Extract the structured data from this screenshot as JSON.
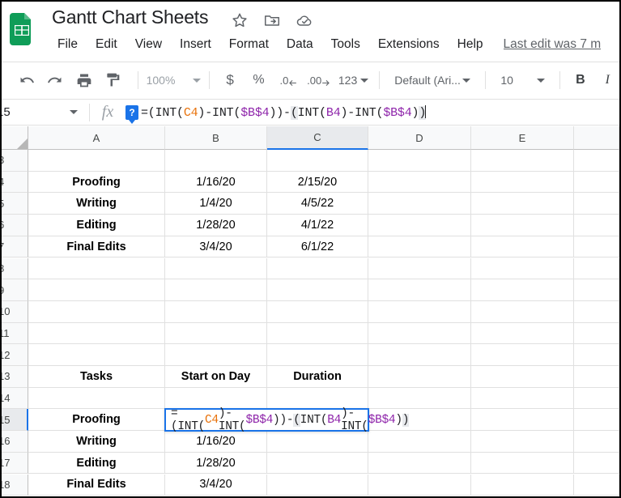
{
  "titlebar": {
    "doc_title": "Gantt Chart Sheets",
    "icons": [
      {
        "name": "star-icon",
        "label": "Star"
      },
      {
        "name": "move-to-folder-icon",
        "label": "Move"
      },
      {
        "name": "cloud-saved-icon",
        "label": "Saved to Drive"
      }
    ],
    "menus": [
      "File",
      "Edit",
      "View",
      "Insert",
      "Format",
      "Data",
      "Tools",
      "Extensions",
      "Help"
    ],
    "last_edit": "Last edit was 7 m"
  },
  "toolbar": {
    "undo": "undo-icon",
    "redo": "redo-icon",
    "print": "print-icon",
    "paint_format": "paint-format-icon",
    "zoom_value": "100%",
    "currency": "$",
    "percent": "%",
    "decrease_decimal": ".0",
    "increase_decimal": ".00",
    "number_format": "123",
    "font_name": "Default (Ari...",
    "font_size": "10",
    "bold": "B",
    "italic": "I"
  },
  "formula_bar": {
    "name_box": "15",
    "fx_label": "fx",
    "help_badge": "?",
    "formula_tokens": [
      {
        "text": "=(INT(",
        "style": "plain"
      },
      {
        "text": "C4",
        "style": "orange"
      },
      {
        "text": ")-INT(",
        "style": "plain"
      },
      {
        "text": "$B$4",
        "style": "purple"
      },
      {
        "text": "))-",
        "style": "plain"
      },
      {
        "text": "(",
        "style": "greybg"
      },
      {
        "text": "INT(",
        "style": "plain"
      },
      {
        "text": "B4",
        "style": "purple"
      },
      {
        "text": ")-INT(",
        "style": "plain"
      },
      {
        "text": "$B$4",
        "style": "purple"
      },
      {
        "text": ")",
        "style": "plain"
      },
      {
        "text": ")",
        "style": "greybg"
      }
    ],
    "formula_plain": "=(INT(C4)-INT($B$4))-(INT(B4)-INT($B$4))"
  },
  "grid": {
    "columns": [
      "A",
      "B",
      "C",
      "D",
      "E",
      ""
    ],
    "selected_column": "C",
    "rows": [
      "3",
      "4",
      "5",
      "6",
      "7",
      "8",
      "9",
      "10",
      "11",
      "12",
      "13",
      "14",
      "15",
      "16",
      "17",
      "18"
    ],
    "selected_row": "15",
    "cells": [
      {
        "row": "4",
        "col": "A",
        "value": "Proofing",
        "bold": true
      },
      {
        "row": "4",
        "col": "B",
        "value": "1/16/20",
        "bold": false
      },
      {
        "row": "4",
        "col": "C",
        "value": "2/15/20",
        "bold": false
      },
      {
        "row": "5",
        "col": "A",
        "value": "Writing",
        "bold": true
      },
      {
        "row": "5",
        "col": "B",
        "value": "1/4/20",
        "bold": false
      },
      {
        "row": "5",
        "col": "C",
        "value": "4/5/22",
        "bold": false
      },
      {
        "row": "6",
        "col": "A",
        "value": "Editing",
        "bold": true
      },
      {
        "row": "6",
        "col": "B",
        "value": "1/28/20",
        "bold": false
      },
      {
        "row": "6",
        "col": "C",
        "value": "4/1/22",
        "bold": false
      },
      {
        "row": "7",
        "col": "A",
        "value": "Final Edits",
        "bold": true
      },
      {
        "row": "7",
        "col": "B",
        "value": "3/4/20",
        "bold": false
      },
      {
        "row": "7",
        "col": "C",
        "value": "6/1/22",
        "bold": false
      },
      {
        "row": "13",
        "col": "A",
        "value": "Tasks",
        "bold": true
      },
      {
        "row": "13",
        "col": "B",
        "value": "Start on Day",
        "bold": true
      },
      {
        "row": "13",
        "col": "C",
        "value": "Duration",
        "bold": true
      },
      {
        "row": "15",
        "col": "A",
        "value": "Proofing",
        "bold": true
      },
      {
        "row": "16",
        "col": "A",
        "value": "Writing",
        "bold": true
      },
      {
        "row": "16",
        "col": "B",
        "value": "1/16/20",
        "bold": false
      },
      {
        "row": "17",
        "col": "A",
        "value": "Editing",
        "bold": true
      },
      {
        "row": "17",
        "col": "B",
        "value": "1/28/20",
        "bold": false
      },
      {
        "row": "18",
        "col": "A",
        "value": "Final Edits",
        "bold": true
      },
      {
        "row": "18",
        "col": "B",
        "value": "3/4/20",
        "bold": false
      }
    ],
    "active_cell_editor": {
      "anchor_row": "15",
      "anchor_col": "B",
      "text": "=(INT(C4)-INT($B$4))-(INT(B4)-INT($B$4))"
    }
  },
  "colors": {
    "brand_green": "#0f9d58",
    "accent_blue": "#1a73e8",
    "ref_orange": "#e8710a",
    "ref_purple": "#8e24aa",
    "header_grey": "#f8f9fa"
  }
}
